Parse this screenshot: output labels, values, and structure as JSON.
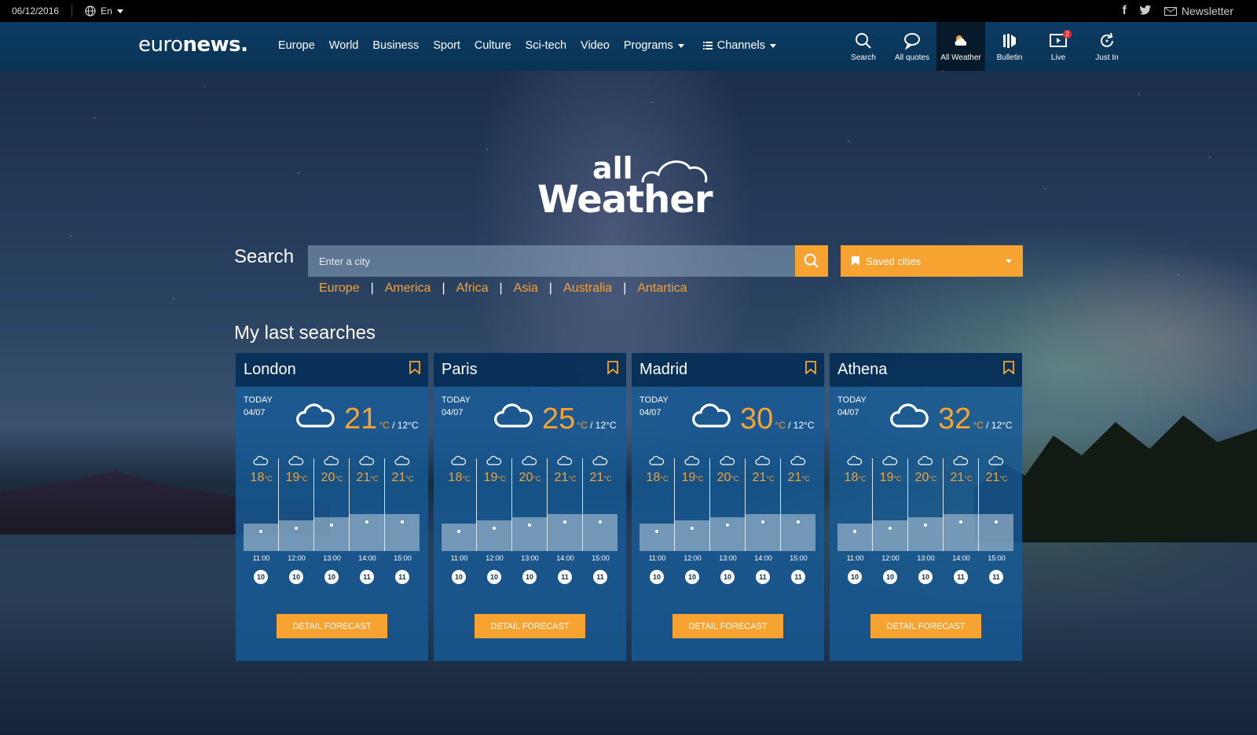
{
  "topbar": {
    "date": "06/12/2016",
    "language": "En",
    "newsletter": "Newsletter"
  },
  "nav": {
    "logo_light": "euro",
    "logo_bold": "news.",
    "menu": [
      "Europe",
      "World",
      "Business",
      "Sport",
      "Culture",
      "Sci-tech",
      "Video",
      "Programs",
      "Channels"
    ],
    "icons": [
      {
        "label": "Search"
      },
      {
        "label": "All quotes"
      },
      {
        "label": "All Weather",
        "active": true
      },
      {
        "label": "Bulletin"
      },
      {
        "label": "Live",
        "badge": "2"
      },
      {
        "label": "Just In"
      }
    ]
  },
  "hero": {
    "logo_top": "all",
    "logo_bottom": "Weather"
  },
  "search": {
    "label": "Search",
    "placeholder": "Enter a city",
    "saved_cities": "Saved cities",
    "regions": [
      "Europe",
      "America",
      "Africa",
      "Asia",
      "Australia",
      "Antartica"
    ]
  },
  "last_searches": {
    "title": "My last searches",
    "detail_label": "DETAIL FORECAST",
    "today_label": "TODAY",
    "cities": [
      {
        "name": "London",
        "date": "04/07",
        "temp": "21",
        "min": "12",
        "hourly_temps": [
          18,
          19,
          20,
          21,
          21
        ],
        "times": [
          "11:00",
          "12:00",
          "13:00",
          "14:00",
          "15:00"
        ],
        "wind": [
          "10",
          "10",
          "10",
          "11",
          "11"
        ]
      },
      {
        "name": "Paris",
        "date": "04/07",
        "temp": "25",
        "min": "12",
        "hourly_temps": [
          18,
          19,
          20,
          21,
          21
        ],
        "times": [
          "11:00",
          "12:00",
          "13:00",
          "14:00",
          "15:00"
        ],
        "wind": [
          "10",
          "10",
          "10",
          "11",
          "11"
        ]
      },
      {
        "name": "Madrid",
        "date": "04/07",
        "temp": "30",
        "min": "12",
        "hourly_temps": [
          18,
          19,
          20,
          21,
          21
        ],
        "times": [
          "11:00",
          "12:00",
          "13:00",
          "14:00",
          "15:00"
        ],
        "wind": [
          "10",
          "10",
          "10",
          "11",
          "11"
        ]
      },
      {
        "name": "Athena",
        "date": "04/07",
        "temp": "32",
        "min": "12",
        "hourly_temps": [
          18,
          19,
          20,
          21,
          21
        ],
        "times": [
          "11:00",
          "12:00",
          "13:00",
          "14:00",
          "15:00"
        ],
        "wind": [
          "10",
          "10",
          "10",
          "11",
          "11"
        ]
      }
    ]
  },
  "colors": {
    "accent": "#f7a332",
    "nav": "#0a3456",
    "card": "#165a96"
  },
  "unit_c": "°C"
}
